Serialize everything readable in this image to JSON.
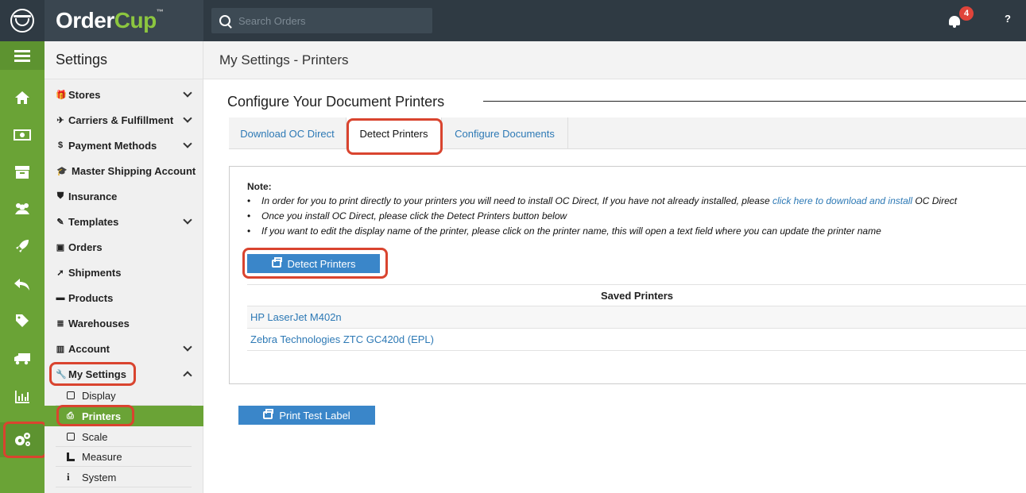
{
  "app": {
    "brand_main": "Order",
    "brand_accent": "Cup",
    "brand_tm": "™"
  },
  "search": {
    "placeholder": "Search Orders"
  },
  "notifications": {
    "count": "4"
  },
  "help": {
    "label": "?"
  },
  "rail": {
    "items": [
      "menu-icon",
      "home-icon",
      "money-icon",
      "archive-icon",
      "users-icon",
      "rocket-icon",
      "reply-icon",
      "tag-icon",
      "truck-icon",
      "chart-icon",
      "cogs-icon"
    ],
    "active": "cogs-icon"
  },
  "sidebar": {
    "title": "Settings",
    "items": [
      {
        "label": "Stores",
        "icon": "gift-icon",
        "chevron": "down"
      },
      {
        "label": "Carriers & Fulfillment",
        "icon": "plane-icon",
        "chevron": "down"
      },
      {
        "label": "Payment Methods",
        "icon": "dollar-icon",
        "prefix": "$",
        "chevron": "down"
      },
      {
        "label": "Master Shipping Account",
        "icon": "graduation-cap-icon"
      },
      {
        "label": "Insurance",
        "icon": "shield-icon"
      },
      {
        "label": "Templates",
        "icon": "edit-icon",
        "chevron": "down"
      },
      {
        "label": "Orders",
        "icon": "money-icon"
      },
      {
        "label": "Shipments",
        "icon": "rocket-icon"
      },
      {
        "label": "Products",
        "icon": "archive-icon"
      },
      {
        "label": "Warehouses",
        "icon": "database-icon"
      },
      {
        "label": "Account",
        "icon": "briefcase-icon",
        "chevron": "down"
      },
      {
        "label": "My Settings",
        "icon": "wrench-icon",
        "chevron": "up"
      }
    ],
    "subitems": [
      {
        "label": "Display",
        "icon": "square-icon"
      },
      {
        "label": "Printers",
        "icon": "print-icon",
        "active": true
      },
      {
        "label": "Scale",
        "icon": "square-icon"
      },
      {
        "label": "Measure",
        "icon": "ruler-icon"
      },
      {
        "label": "System",
        "icon": "info-icon"
      }
    ]
  },
  "main": {
    "page_title": "My Settings - Printers",
    "section_title": "Configure Your Document Printers",
    "tabs": [
      {
        "label": "Download OC Direct"
      },
      {
        "label": "Detect Printers",
        "active": true
      },
      {
        "label": "Configure Documents"
      }
    ],
    "note": {
      "head": "Note:",
      "line1_pre": "In order for you to print directly to your printers you will need to install OC Direct, If you have not already installed, please ",
      "line1_link": "click here to download and install",
      "line1_post": " OC Direct",
      "line2": "Once you install OC Direct, please click the Detect Printers button below",
      "line3": "If you want to edit the display name of the printer, please click on the printer name, this will open a text field where you can update the printer name"
    },
    "detect_button": "Detect Printers",
    "table": {
      "header": "Saved Printers",
      "rows": [
        "HP LaserJet M402n",
        "Zebra Technologies ZTC GC420d (EPL)"
      ]
    },
    "print_test_button": "Print Test Label"
  },
  "colors": {
    "rail_green": "#6aa336",
    "topbar": "#2f3a43",
    "link_blue": "#2d79b5",
    "button_blue": "#3a86c9",
    "highlight_red": "#d9442f"
  }
}
